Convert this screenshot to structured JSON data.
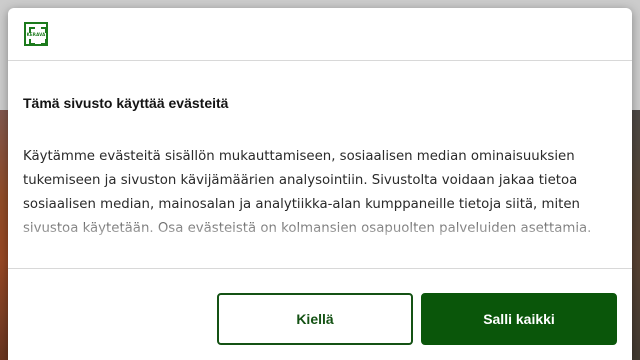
{
  "logo": {
    "text": "KERAVA"
  },
  "dialog": {
    "title": "Tämä sivusto käyttää evästeitä",
    "body": "Käytämme evästeitä sisällön mukauttamiseen, sosiaalisen median ominaisuuksien tukemiseen ja sivuston kävijämäärien analysointiin. Sivustolta voidaan jakaa tietoa sosiaalisen median, mainosalan ja analytiikka-alan kumppaneille tietoja siitä, miten sivustoa käytetään. Osa evästeistä on kolmansien osapuolten palveluiden asettamia."
  },
  "buttons": {
    "deny_label": "Kiellä",
    "allow_label": "Salli kaikki"
  },
  "colors": {
    "brand_green": "#0a560a",
    "logo_green": "#1c7a1c"
  }
}
